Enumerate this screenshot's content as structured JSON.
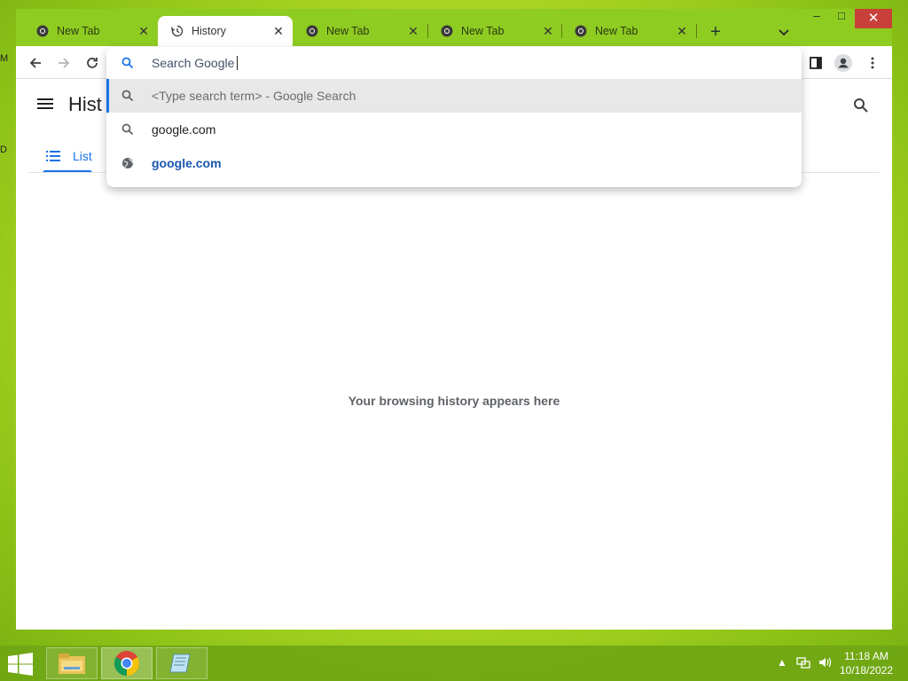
{
  "desktop": {
    "edge_labels": [
      "M",
      "D"
    ]
  },
  "browser": {
    "tabs": [
      {
        "title": "New Tab",
        "icon": "chrome-icon",
        "active": false
      },
      {
        "title": "History",
        "icon": "history-icon",
        "active": true
      },
      {
        "title": "New Tab",
        "icon": "chrome-icon",
        "active": false
      },
      {
        "title": "New Tab",
        "icon": "chrome-icon",
        "active": false
      },
      {
        "title": "New Tab",
        "icon": "chrome-icon",
        "active": false
      }
    ],
    "new_tab_label": "+",
    "window_controls": {
      "minimize": "–",
      "maximize": "□",
      "close": "✕"
    }
  },
  "omnibox": {
    "placeholder": "Search Google",
    "suggestions": [
      {
        "text": "<Type search term>",
        "suffix": " - Google Search",
        "icon": "search-icon",
        "selected": true
      },
      {
        "text": "google.com",
        "suffix": "",
        "icon": "search-icon",
        "selected": false
      },
      {
        "text": "google.com",
        "suffix": "",
        "icon": "globe-icon",
        "selected": false
      }
    ]
  },
  "page": {
    "title": "Hist",
    "nav_tab": "List",
    "empty_message": "Your browsing history appears here"
  },
  "taskbar": {
    "time": "11:18 AM",
    "date": "10/18/2022"
  },
  "colors": {
    "accent": "#1a73e8",
    "frame": "#8fcc22",
    "close_button": "#c9403a"
  }
}
